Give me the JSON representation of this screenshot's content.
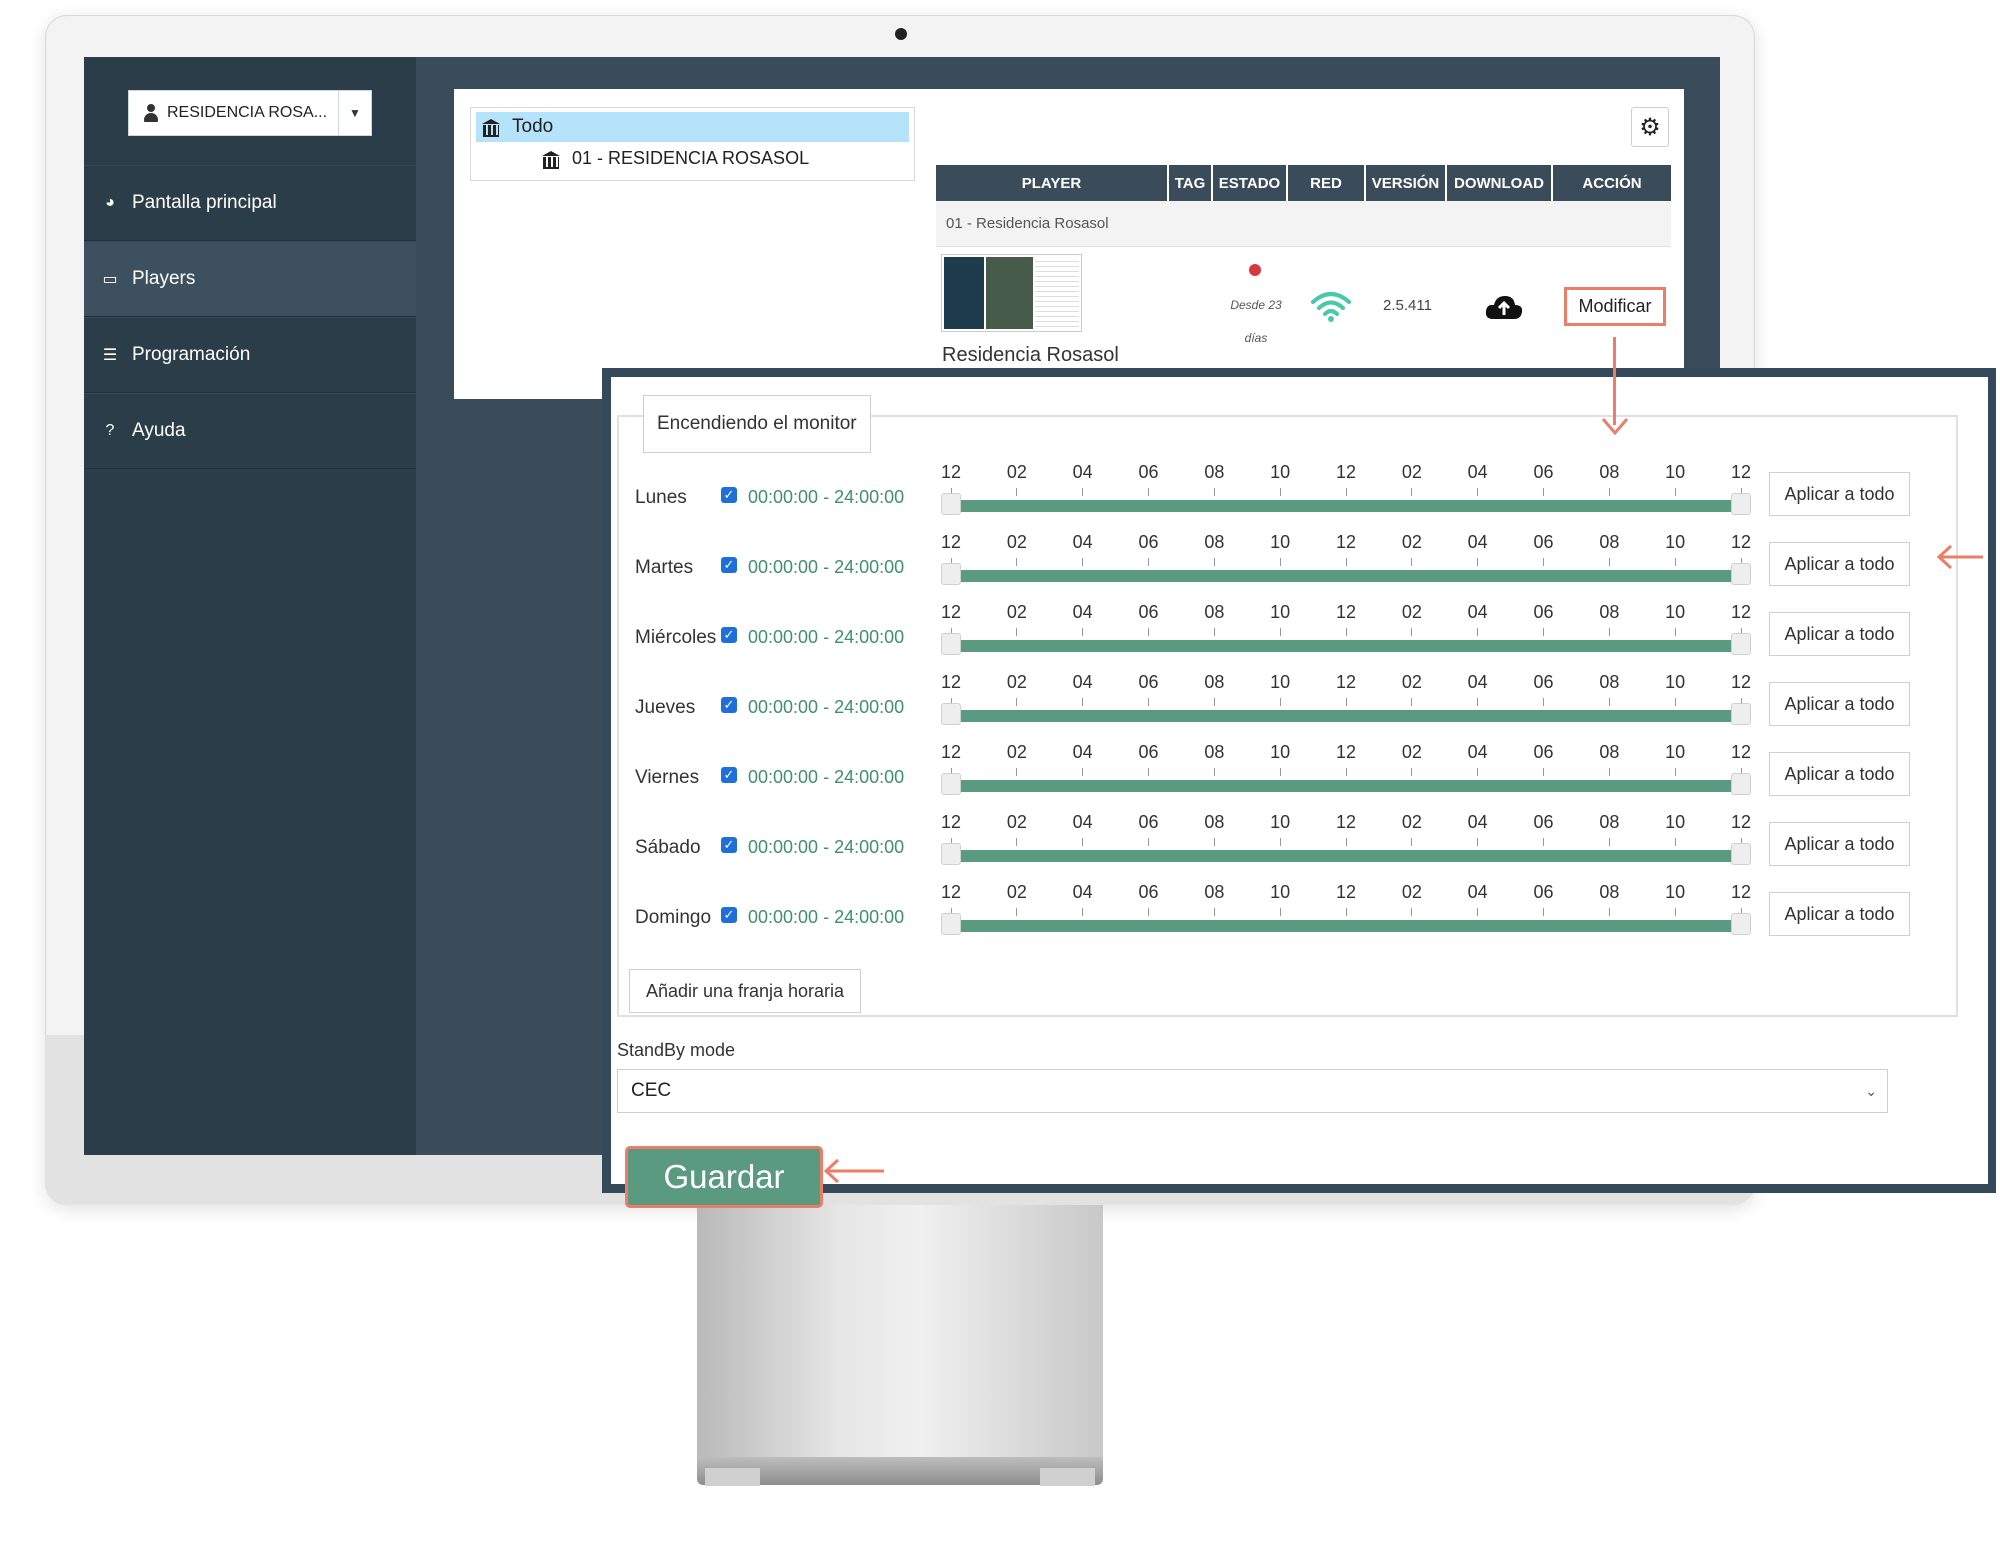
{
  "sidebar": {
    "account": "RESIDENCIA ROSA...",
    "items": [
      {
        "label": "Pantalla principal",
        "icon": "dashboard-icon"
      },
      {
        "label": "Players",
        "icon": "monitor-icon"
      },
      {
        "label": "Programación",
        "icon": "sliders-icon"
      },
      {
        "label": "Ayuda",
        "icon": "question-icon"
      }
    ]
  },
  "tree": {
    "root": "Todo",
    "child": "01 -  RESIDENCIA ROSASOL"
  },
  "table": {
    "headers": [
      "PLAYER",
      "TAG",
      "ESTADO",
      "RED",
      "VERSIÓN",
      "DOWNLOAD",
      "ACCIÓN"
    ],
    "group": "01 -  Residencia Rosasol",
    "row": {
      "name": "Residencia Rosasol",
      "status": "Desde 23 días",
      "version": "2.5.411",
      "action": "Modificar"
    }
  },
  "schedule": {
    "legend": "Encendiendo el monitor",
    "ticks": [
      "12",
      "02",
      "04",
      "06",
      "08",
      "10",
      "12",
      "02",
      "04",
      "06",
      "08",
      "10",
      "12"
    ],
    "range_start_hour": 0,
    "range_end_hour": 24,
    "days": [
      {
        "day": "Lunes",
        "time": "00:00:00 - 24:00:00",
        "apply": "Aplicar a todo"
      },
      {
        "day": "Martes",
        "time": "00:00:00 - 24:00:00",
        "apply": "Aplicar a todo"
      },
      {
        "day": "Miércoles",
        "time": "00:00:00 - 24:00:00",
        "apply": "Aplicar a todo"
      },
      {
        "day": "Jueves",
        "time": "00:00:00 - 24:00:00",
        "apply": "Aplicar a todo"
      },
      {
        "day": "Viernes",
        "time": "00:00:00 - 24:00:00",
        "apply": "Aplicar a todo"
      },
      {
        "day": "Sábado",
        "time": "00:00:00 - 24:00:00",
        "apply": "Aplicar a todo"
      },
      {
        "day": "Domingo",
        "time": "00:00:00 - 24:00:00",
        "apply": "Aplicar a todo"
      }
    ],
    "add_slot": "Añadir una franja horaria",
    "standby_label": "StandBy mode",
    "standby_value": "CEC",
    "save": "Guardar"
  },
  "colors": {
    "sidebar": "#2c3d4a",
    "accent_green": "#5a9a80",
    "highlight": "#ed7d66",
    "status_red": "#d9363e",
    "wifi": "#48c9a9"
  }
}
